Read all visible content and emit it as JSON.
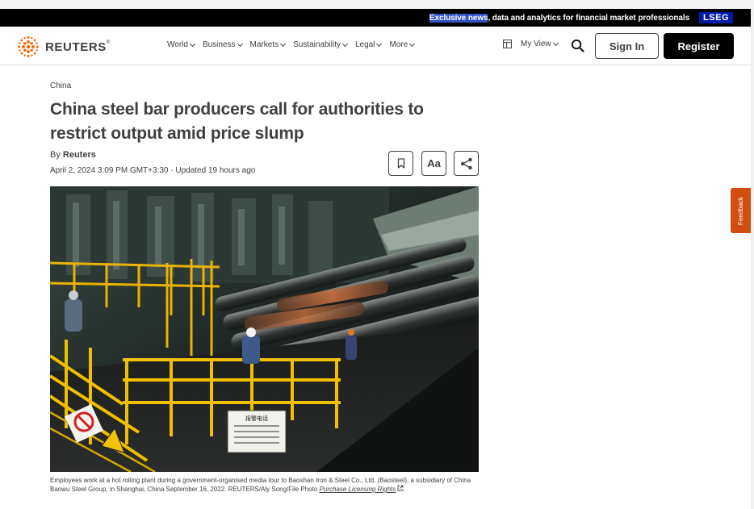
{
  "promo": {
    "highlight": "Exclusive news",
    "text": ", data and analytics for financial market professionals",
    "brand": "LSEG"
  },
  "header": {
    "logo_text": "REUTERS",
    "logo_mark": "®",
    "nav": [
      "World",
      "Business",
      "Markets",
      "Sustainability",
      "Legal",
      "More"
    ],
    "my_view": "My View",
    "sign_in": "Sign In",
    "register": "Register"
  },
  "article": {
    "kicker": "China",
    "headline": "China steel bar producers call for authorities to restrict output amid price slump",
    "by_prefix": "By ",
    "author": "Reuters",
    "dateline": "April 2, 2024 3:09 PM GMT+3:30 · Updated 19 hours ago",
    "font_tool": "Aa",
    "caption": "Employees work at a hot rolling plant during a government-organised media tour to Baoshan Iron & Steel Co., Ltd. (Baosteel), a subsidiary of China Baowu Steel Group, in Shanghai, China September 16, 2022. REUTERS/Aly Song/File Photo ",
    "licensing": "Purchase Licensing Rights",
    "sign_text": "报警电话"
  },
  "feedback": "Feedback",
  "colors": {
    "accent_orange": "#d14e0f",
    "lseg_blue": "#0019a5",
    "text": "#404040"
  }
}
